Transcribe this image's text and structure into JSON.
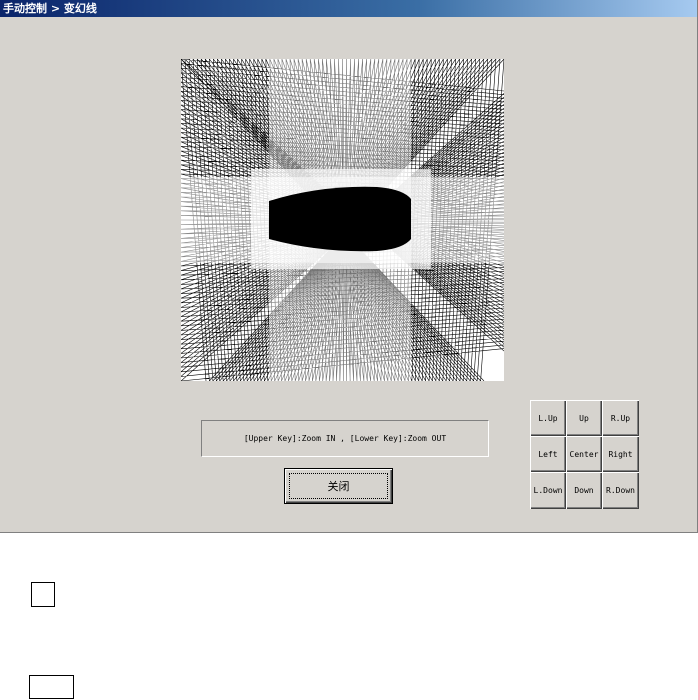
{
  "window": {
    "title": "手动控制 > 变幻线"
  },
  "colors": {
    "title_bar": "#0a246a",
    "dialog_bg": "#d6d3ce",
    "drawing_line": "#000000",
    "drawing_bg": "#ffffff"
  },
  "status": {
    "hint": "[Upper Key]:Zoom IN , [Lower Key]:Zoom OUT"
  },
  "buttons": {
    "close_label": "关闭"
  },
  "direction_pad": [
    {
      "id": "lup",
      "label": "L.Up"
    },
    {
      "id": "up",
      "label": "Up"
    },
    {
      "id": "rup",
      "label": "R.Up"
    },
    {
      "id": "left",
      "label": "Left"
    },
    {
      "id": "center",
      "label": "Center"
    },
    {
      "id": "right",
      "label": "Right"
    },
    {
      "id": "ldown",
      "label": "L.Down"
    },
    {
      "id": "down",
      "label": "Down"
    },
    {
      "id": "rdown",
      "label": "R.Down"
    }
  ]
}
